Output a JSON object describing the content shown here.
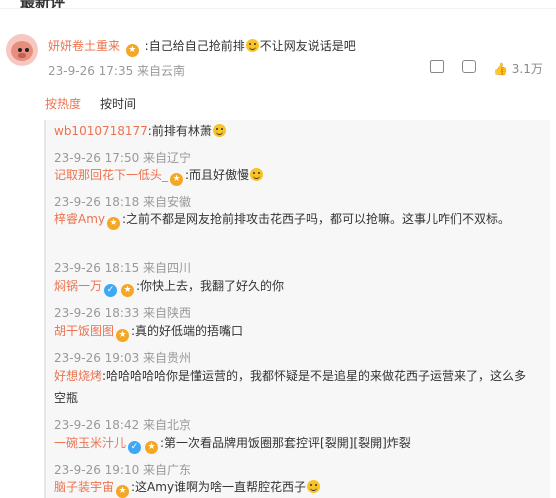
{
  "top_title": "最新评",
  "main": {
    "username": "妍妍卷土重来",
    "text_a": ":自己给自己抢前排",
    "text_b": "不让网友说话是吧",
    "meta": "23-9-26 17:35 来自云南",
    "like_count": "3.1万"
  },
  "sort": {
    "hot": "按热度",
    "time": "按时间"
  },
  "replies": [
    {
      "name": "wb1010718177",
      "text": ":前排有林萧",
      "meta": "23-9-26 17:50 来自辽宁"
    },
    {
      "name": "记取那回花下一低头_",
      "text": ":而且好傲慢",
      "meta": "23-9-26 18:18 来自安徽"
    },
    {
      "name": "梓睿Amy",
      "text": ":之前不都是网友抢前排攻击花西子吗，都可以抢嘛。这事儿咋们不双标。",
      "meta": "23-9-26 18:15 来自四川"
    },
    {
      "name": "焖锅一万",
      "text": ":你快上去，我翻了好久的你",
      "meta": "23-9-26 18:33 来自陕西"
    },
    {
      "name": "胡干饭图图",
      "text": ":真的好低端的捂嘴口",
      "meta": "23-9-26 19:03 来自贵州"
    },
    {
      "name": "好想烧烤",
      "text": ":哈哈哈哈哈你是懂运营的，我都怀疑是不是追星的来做花西子运营来了，这么多空瓶",
      "meta": "23-9-26 18:42 来自北京"
    },
    {
      "name": "一碗玉米汁儿",
      "text": ":第一次看品牌用饭圈那套控评[裂開][裂開]炸裂",
      "meta": "23-9-26 19:10 来自广东"
    },
    {
      "name": "脑子装宇宙",
      "text": ":这Amy谁啊为啥一直帮腔花西子",
      "meta": ""
    }
  ]
}
